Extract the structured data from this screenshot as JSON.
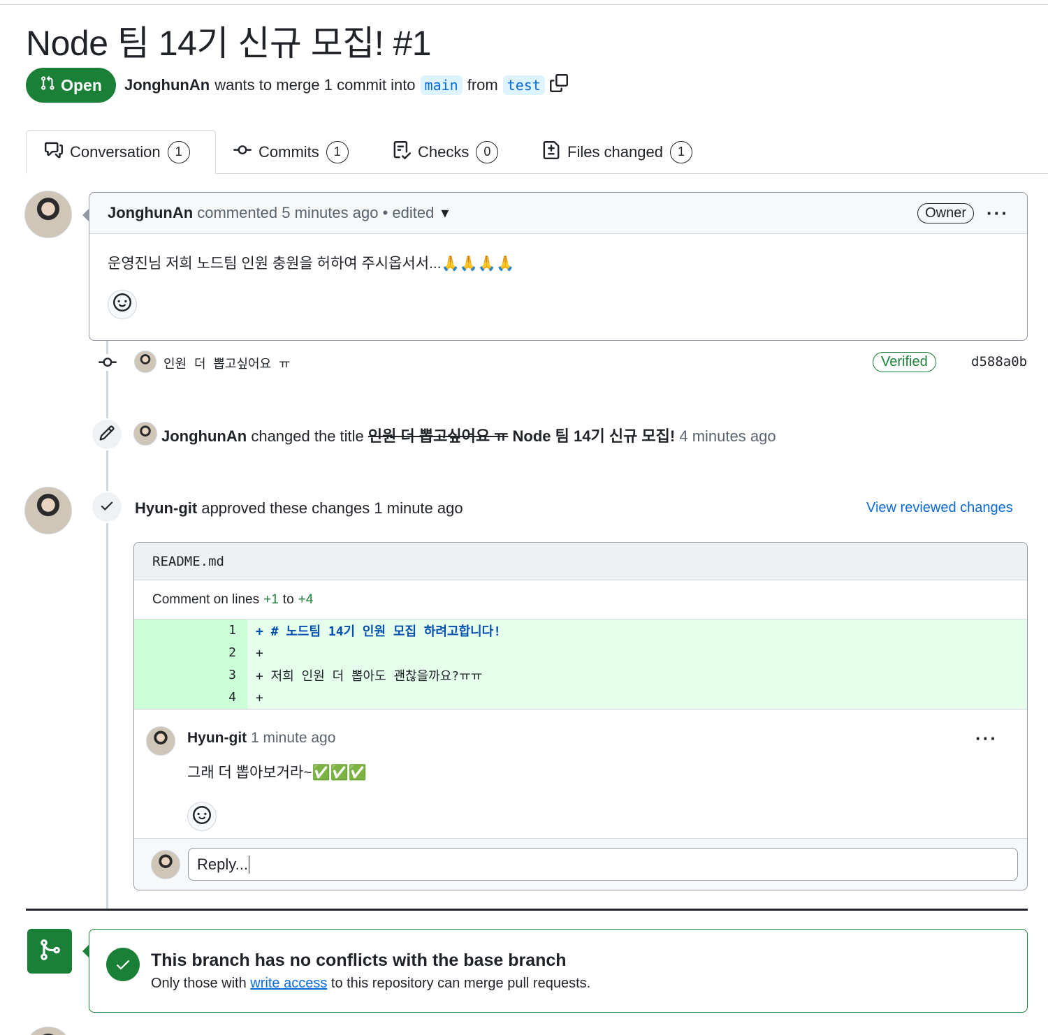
{
  "pr": {
    "title": "Node 팀 14기 신규 모집! #1",
    "state": "Open",
    "author": "JonghunAn",
    "merge_text": "wants to merge 1 commit into",
    "base_branch": "main",
    "from_text": "from",
    "head_branch": "test"
  },
  "tabs": [
    {
      "label": "Conversation",
      "count": "1"
    },
    {
      "label": "Commits",
      "count": "1"
    },
    {
      "label": "Checks",
      "count": "0"
    },
    {
      "label": "Files changed",
      "count": "1"
    }
  ],
  "comment": {
    "author": "JonghunAn",
    "meta": "commented 5 minutes ago • edited",
    "role": "Owner",
    "body": "운영진님 저희 노드팀 인원 충원을 허하여 주시옵서서...🙏🙏🙏🙏"
  },
  "commit": {
    "message": "인원 더 뽑고싶어요 ㅠ",
    "verified": "Verified",
    "sha": "d588a0b"
  },
  "title_change": {
    "author": "JonghunAn",
    "text": "changed the title",
    "old_title": "인원 더 뽑고싶어요 ㅠ",
    "new_title": "Node 팀 14기 신규 모집!",
    "time": "4 minutes ago"
  },
  "review": {
    "author": "Hyun-git",
    "text": "approved these changes 1 minute ago",
    "view_link": "View reviewed changes",
    "file": "README.md",
    "range_prefix": "Comment on lines",
    "range_start": "+1",
    "range_to": "to",
    "range_end": "+4",
    "lines": [
      {
        "num": "1",
        "code": "+ # 노드팀 14기 인원 모집 하려고합니다!"
      },
      {
        "num": "2",
        "code": "+"
      },
      {
        "num": "3",
        "code": "+ 저희 인원 더 뽑아도 괜찮을까요?ㅠㅠ"
      },
      {
        "num": "4",
        "code": "+"
      }
    ],
    "reply_author": "Hyun-git",
    "reply_time": "1 minute ago",
    "reply_body": "그래 더 뽑아보거라~✅✅✅",
    "reply_input": "Reply..."
  },
  "merge": {
    "title": "This branch has no conflicts with the base branch",
    "body_pre": "Only those with",
    "body_link": "write access",
    "body_post": "to this repository can merge pull requests."
  },
  "colors": {
    "green": "#1a7f37",
    "blue": "#0969da",
    "diff_add": "#e6ffec",
    "diff_num": "#ccffd8"
  }
}
